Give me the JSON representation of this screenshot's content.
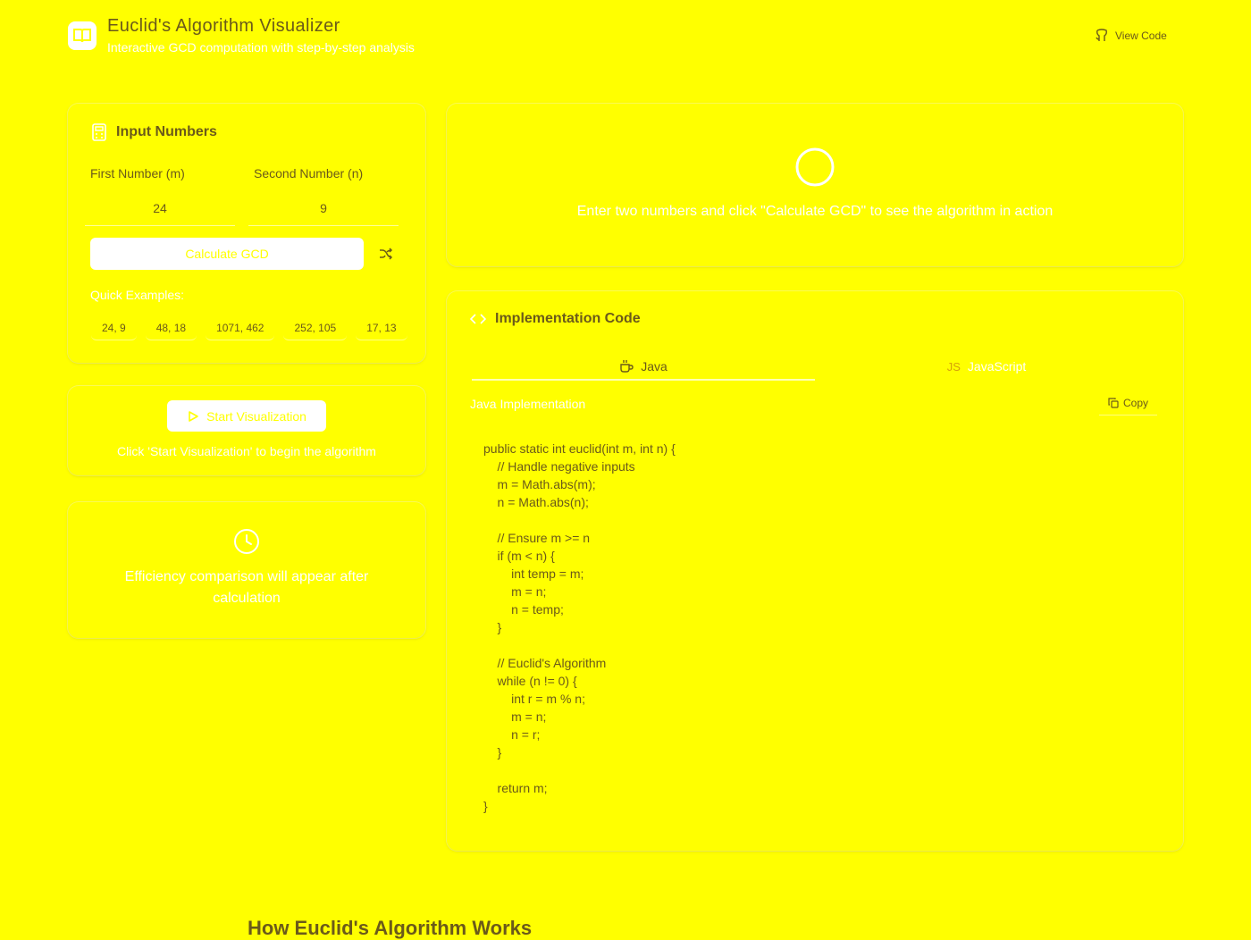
{
  "header": {
    "title": "Euclid's Algorithm Visualizer",
    "subtitle": "Interactive GCD computation with step-by-step analysis",
    "view_code": "View Code"
  },
  "input_card": {
    "title": "Input Numbers",
    "first_label": "First Number (m)",
    "second_label": "Second Number (n)",
    "first_value": "24",
    "second_value": "9",
    "calculate_label": "Calculate GCD",
    "quick_label": "Quick Examples:",
    "examples": [
      "24, 9",
      "48, 18",
      "1071, 462",
      "252, 105",
      "17, 13"
    ]
  },
  "viz_card": {
    "start_label": "Start Visualization",
    "hint": "Click 'Start Visualization' to begin the algorithm"
  },
  "efficiency_card": {
    "message": "Efficiency comparison will appear after calculation"
  },
  "result_card": {
    "message": "Enter two numbers and click \"Calculate GCD\" to see the algorithm in action"
  },
  "code_card": {
    "title": "Implementation Code",
    "tabs": [
      {
        "label": "Java",
        "active": true
      },
      {
        "label": "JavaScript",
        "prefix": "JS",
        "active": false
      }
    ],
    "impl_label": "Java Implementation",
    "copy_label": "Copy",
    "code": "public static int euclid(int m, int n) {\n    // Handle negative inputs\n    m = Math.abs(m);\n    n = Math.abs(n);\n\n    // Ensure m >= n\n    if (m < n) {\n        int temp = m;\n        m = n;\n        n = temp;\n    }\n\n    // Euclid's Algorithm\n    while (n != 0) {\n        int r = m % n;\n        m = n;\n        n = r;\n    }\n\n    return m;\n}"
  },
  "section": {
    "heading": "How Euclid's Algorithm Works"
  },
  "colors": {
    "background": "#ffff00",
    "text": "#6b5a1a",
    "white": "#ffffff"
  }
}
